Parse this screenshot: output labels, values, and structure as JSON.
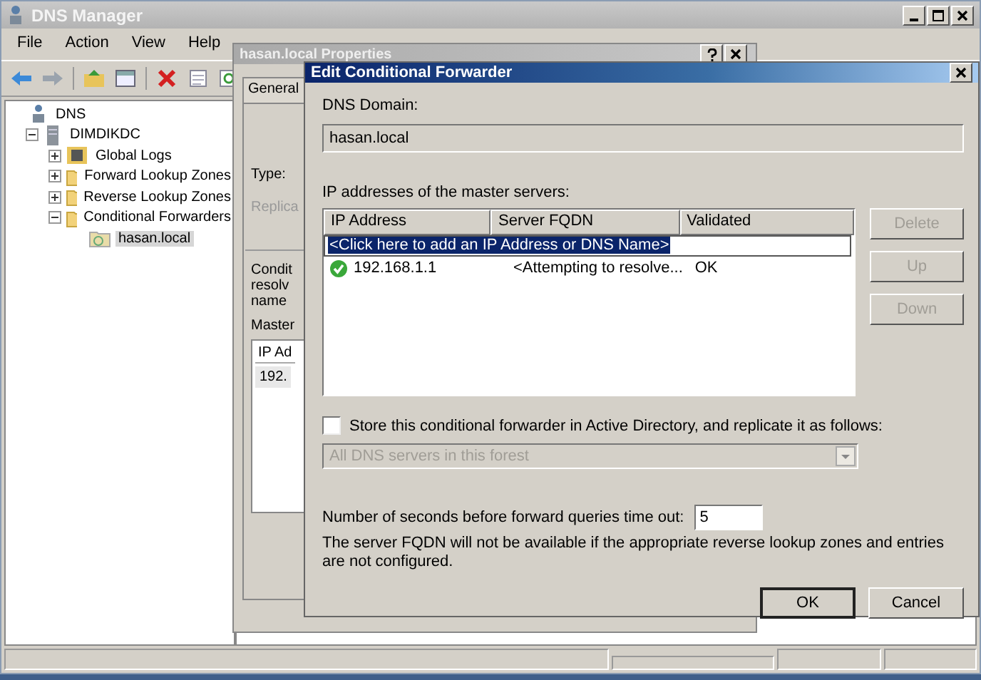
{
  "main_window": {
    "title": "DNS Manager",
    "menu": [
      "File",
      "Action",
      "View",
      "Help"
    ],
    "tree": [
      {
        "label": "DNS",
        "kind": "root",
        "selected": false,
        "children": [
          {
            "label": "DIMDIKDC",
            "kind": "server",
            "expanded": true,
            "selected": false,
            "children": [
              {
                "label": "Global Logs",
                "kind": "log",
                "expanded": false,
                "selected": false
              },
              {
                "label": "Forward Lookup Zones",
                "kind": "folder",
                "expanded": false,
                "selected": false
              },
              {
                "label": "Reverse Lookup Zones",
                "kind": "folder",
                "expanded": false,
                "selected": false
              },
              {
                "label": "Conditional Forwarders",
                "kind": "folder",
                "expanded": true,
                "selected": false,
                "children": [
                  {
                    "label": "hasan.local",
                    "kind": "forwarder",
                    "selected": true
                  }
                ]
              }
            ]
          }
        ]
      }
    ]
  },
  "properties_dialog": {
    "title": "hasan.local Properties",
    "tabs": [
      {
        "label": "General",
        "selected": true
      }
    ],
    "type_label": "Type:",
    "replication_label": "Replica",
    "description": [
      "Condit",
      "resolv",
      "name"
    ],
    "masters_label": "Master",
    "table": {
      "columns": [
        "IP Ad"
      ],
      "rows": [
        "192."
      ]
    }
  },
  "edit_dialog": {
    "title": "Edit Conditional Forwarder",
    "domain_label": "DNS Domain:",
    "domain": "hasan.local",
    "masters_label": "IP addresses of the master servers:",
    "table": {
      "columns": [
        "IP Address",
        "Server FQDN",
        "Validated"
      ],
      "add_row": {
        "label": "<Click here to add an IP Address or DNS Name>",
        "selected": true
      },
      "rows": [
        {
          "ip": "192.168.1.1",
          "fqdn": "<Attempting to resolve...",
          "validated": "OK",
          "valid": true
        }
      ]
    },
    "side_buttons": [
      {
        "label": "Delete",
        "disabled": true
      },
      {
        "label": "Up",
        "disabled": true
      },
      {
        "label": "Down",
        "disabled": true
      }
    ],
    "store_checkbox": {
      "label": "Store this conditional forwarder in Active Directory, and replicate it as follows:",
      "checked": false
    },
    "replication_dropdown": {
      "value": "All DNS servers in this forest",
      "disabled": true
    },
    "timeout_label": "Number of seconds before forward queries time out:",
    "timeout": "5",
    "note": "The server FQDN will not be available if the appropriate reverse lookup zones and entries are not configured.",
    "buttons": [
      {
        "label": "OK",
        "default": true
      },
      {
        "label": "Cancel",
        "default": false
      }
    ]
  }
}
